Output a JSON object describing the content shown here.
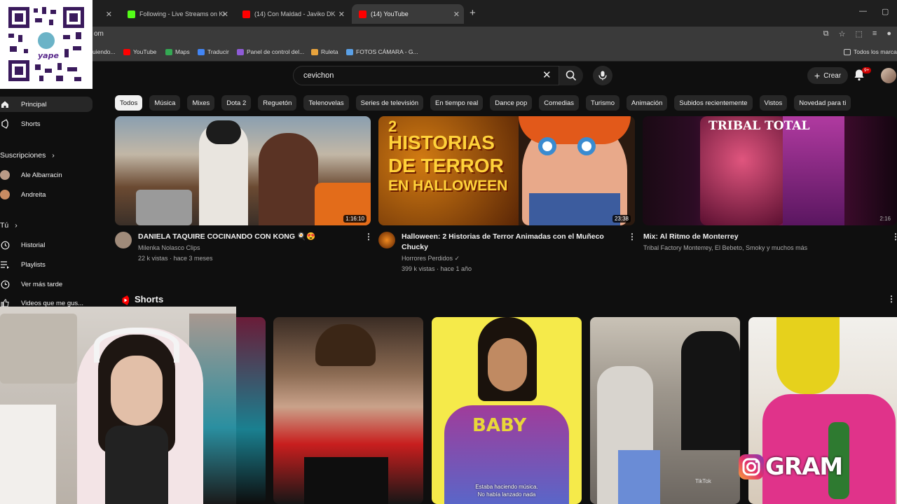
{
  "browser": {
    "tabs": [
      {
        "label": "Following - Live Streams on Ki",
        "color": "#53fc18"
      },
      {
        "label": "(14) Con Maldad - Javiko DK",
        "color": "#ff0000"
      },
      {
        "label": "(14) YouTube",
        "color": "#ff0000"
      }
    ],
    "url": "om",
    "bookmarks": [
      "uiendo...",
      "YouTube",
      "Maps",
      "Traducir",
      "Panel de control del...",
      "Ruleta",
      "FOTOS CÁMARA - G..."
    ],
    "bookmarks_right": "Todos los marca"
  },
  "header": {
    "search_value": "cevichon",
    "create_label": "Crear",
    "notif_badge": "9+"
  },
  "chips": [
    "Todos",
    "Música",
    "Mixes",
    "Dota 2",
    "Reguetón",
    "Telenovelas",
    "Series de televisión",
    "En tiempo real",
    "Dance pop",
    "Comedias",
    "Turismo",
    "Animación",
    "Subidos recientemente",
    "Vistos",
    "Novedad para ti"
  ],
  "sidebar": {
    "principal": "Principal",
    "shorts": "Shorts",
    "subs_heading": "Suscripciones",
    "subs": [
      "Ale Albarracin",
      "Andreita"
    ],
    "you_heading": "Tú",
    "historial": "Historial",
    "playlists": "Playlists",
    "ver_mas_tarde": "Ver más tarde",
    "videos_gustan": "Videos que me gus..."
  },
  "videos": [
    {
      "title": "DANIELA TAQUIRE COCINANDO CON KONG 🍳😍",
      "channel": "Milenka Nolasco Clips",
      "meta": "22 k vistas · hace 3 meses",
      "duration": "1:16:10"
    },
    {
      "title_line1": "Halloween: 2 Historias de Terror Animadas con el Muñeco",
      "title_line2": "Chucky",
      "channel": "Horrores Perdidos ✓",
      "meta": "399 k vistas · hace 1 año",
      "duration": "23:38",
      "thumb_text_1": "2",
      "thumb_text_2": "HISTORIAS",
      "thumb_text_3": "DE TERROR",
      "thumb_text_4": "EN HALLOWEEN"
    },
    {
      "title": "Mix: Al Ritmo de Monterrey",
      "meta": "Tribal Factory Monterrey, El Bebeto, Smoky y muchos más",
      "duration": "2:16",
      "thumb_text": "TRIBAL TOTAL"
    }
  ],
  "shorts_heading": "Shorts",
  "overlays": {
    "qr_label": "yape",
    "instagram_text": "GRAM",
    "caption_line1": "Estaba haciendo música.",
    "caption_line2": "No había lanzado nada",
    "tiktok": "TikTok",
    "shirt_text": "BABY"
  },
  "colors": {
    "accent": "#ff0000",
    "bg": "#0f0f0f",
    "chip": "#272727"
  }
}
